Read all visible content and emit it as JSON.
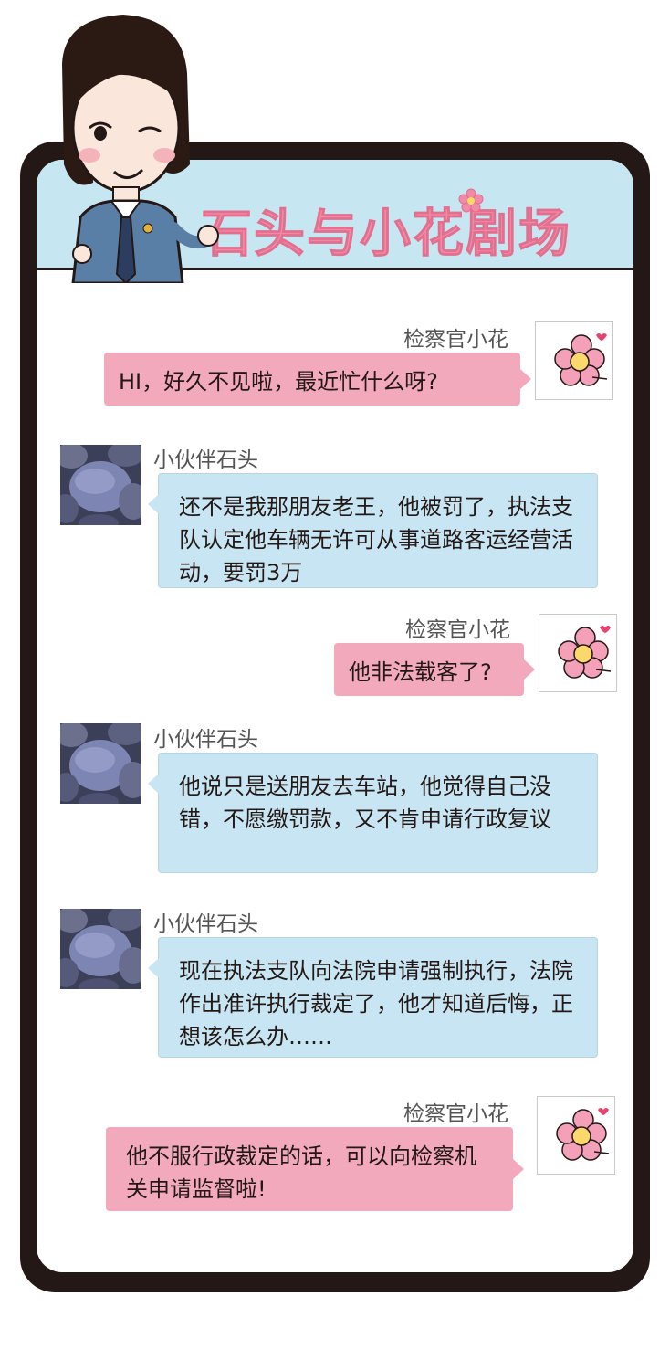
{
  "header": {
    "title": "石头与小花剧场"
  },
  "colors": {
    "frame": "#231815",
    "banner": "#c6e6f1",
    "pink_bubble": "#f2a9bb",
    "blue_bubble": "#c7e5f2",
    "title": "#f08aa6"
  },
  "messages": [
    {
      "sender": "检察官小花",
      "text": "HI，好久不见啦，最近忙什么呀?"
    },
    {
      "sender": "小伙伴石头",
      "text": "还不是我那朋友老王，他被罚了，执法支队认定他车辆无许可从事道路客运经营活动，要罚3万"
    },
    {
      "sender": "检察官小花",
      "text": "他非法载客了?"
    },
    {
      "sender": "小伙伴石头",
      "text": "他说只是送朋友去车站，他觉得自己没错，不愿缴罚款，又不肯申请行政复议"
    },
    {
      "sender": "小伙伴石头",
      "text": "现在执法支队向法院申请强制执行，法院作出准许执行裁定了，他才知道后悔，正想该怎么办……"
    },
    {
      "sender": "检察官小花",
      "text": "他不服行政裁定的话，可以向检察机关申请监督啦!"
    }
  ]
}
